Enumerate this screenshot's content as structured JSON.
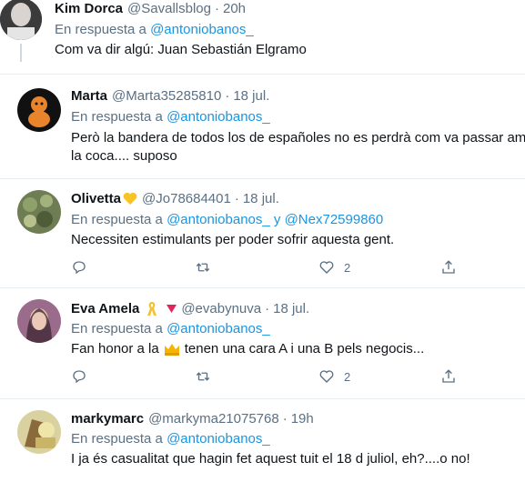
{
  "tweets": [
    {
      "name": "Kim Dorca",
      "handle": "@Savallsblog",
      "time": "20h",
      "reply_prefix": "En respuesta a",
      "reply_to": "@antoniobanos_",
      "text": "Com va dir algú: Juan Sebastián Elgramo"
    },
    {
      "name": "Marta",
      "handle": "@Marta35285810",
      "time": "18 jul.",
      "reply_prefix": "En respuesta a",
      "reply_to": "@antoniobanos_",
      "text_line1": "Però la bandera de todos los de españoles no es perdrà com va passar amb",
      "text_line2": "la coca.... suposo"
    },
    {
      "name": "Olivetta",
      "handle": "@Jo78684401",
      "time": "18 jul.",
      "reply_prefix": "En respuesta a",
      "reply_to": "@antoniobanos_",
      "reply_and": "y",
      "reply_to2": "@Nex72599860",
      "text": "Necessiten estimulants per poder sofrir aquesta gent.",
      "like_count": "2"
    },
    {
      "name": "Eva Amela",
      "handle": "@evabynuva",
      "time": "18 jul.",
      "reply_prefix": "En respuesta a",
      "reply_to": "@antoniobanos_",
      "text_before": "Fan honor a la",
      "text_after": "tenen una cara A i una B pels negocis...",
      "like_count": "2"
    },
    {
      "name": "markymarc",
      "handle": "@markyma21075768",
      "time": "19h",
      "reply_prefix": "En respuesta a",
      "reply_to": "@antoniobanos_",
      "text": "I ja és casualitat que hagin fet aquest tuit el 18 d juliol, eh?....o no!"
    }
  ],
  "dot": "·",
  "colors": {
    "link": "#1b95e0",
    "secondary": "#5b7083",
    "heart_emoji": "#f7c325",
    "ribbon": "#f2c230",
    "triangle": "#e0245e"
  }
}
